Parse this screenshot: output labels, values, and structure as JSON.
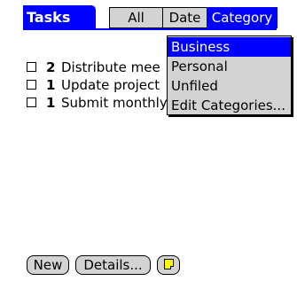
{
  "header": {
    "title": "Tasks",
    "filters": [
      "All",
      "Date",
      "Category"
    ],
    "selected_filter": "Category"
  },
  "tasks": [
    {
      "priority": "2",
      "description": "Distribute mee",
      "checked": false
    },
    {
      "priority": "1",
      "description": "Update project",
      "checked": false
    },
    {
      "priority": "1",
      "description": "Submit monthly",
      "checked": false
    }
  ],
  "category_menu": {
    "items": [
      "Business",
      "Personal",
      "Unfiled",
      "Edit Categories..."
    ],
    "selected": "Business"
  },
  "buttons": {
    "new": "New",
    "details": "Details...",
    "note_icon": "note-icon"
  },
  "colors": {
    "accent": "#0000ff",
    "button_bg": "#d3d3d3",
    "note": "#ffff00"
  }
}
